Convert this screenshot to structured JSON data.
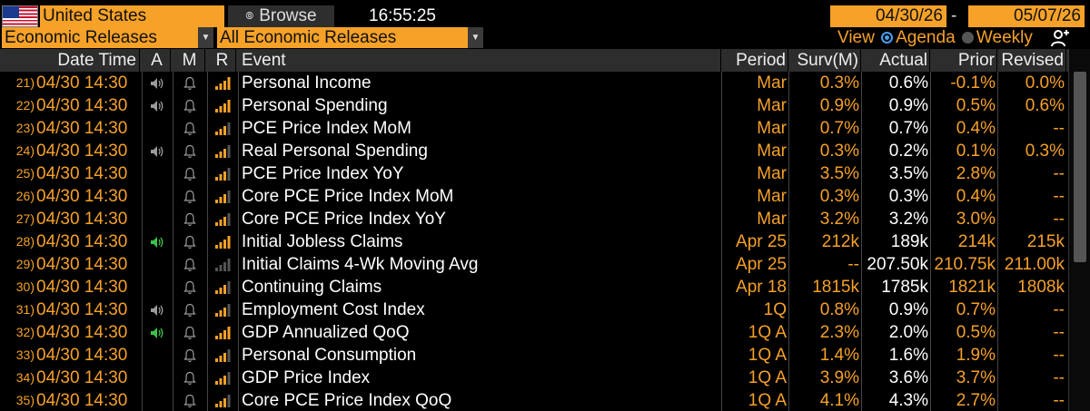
{
  "toolbar": {
    "country": "United States",
    "browse_label": "Browse",
    "time": "16:55:25",
    "date_from": "04/30/26",
    "date_separator": "-",
    "date_to": "05/07/26",
    "release_type": "Economic Releases",
    "release_filter": "All Economic Releases",
    "view_label": "View",
    "view_agenda": "Agenda",
    "view_weekly": "Weekly",
    "selected_view": "Agenda"
  },
  "colors": {
    "accent": "#f6a128",
    "bar_active": "#f6a128",
    "bar_inactive": "#555555",
    "speaker_active": "#3cc24a",
    "speaker_inactive": "#9a9a9a"
  },
  "table": {
    "headers": {
      "date_time": "Date Time",
      "a": "A",
      "m": "M",
      "r": "R",
      "event": "Event",
      "period": "Period",
      "surv": "Surv(M)",
      "actual": "Actual",
      "prior": "Prior",
      "revised": "Revised"
    },
    "rows": [
      {
        "num": "21)",
        "date": "04/30 14:30",
        "speaker": "inactive",
        "relevance": 4,
        "event": "Personal Income",
        "period": "Mar",
        "surv": "0.3%",
        "actual": "0.6%",
        "prior": "-0.1%",
        "revised": "0.0%"
      },
      {
        "num": "22)",
        "date": "04/30 14:30",
        "speaker": "inactive",
        "relevance": 4,
        "event": "Personal Spending",
        "period": "Mar",
        "surv": "0.9%",
        "actual": "0.9%",
        "prior": "0.5%",
        "revised": "0.6%"
      },
      {
        "num": "23)",
        "date": "04/30 14:30",
        "speaker": "none",
        "relevance": 3,
        "event": "PCE Price Index MoM",
        "period": "Mar",
        "surv": "0.7%",
        "actual": "0.7%",
        "prior": "0.4%",
        "revised": "--"
      },
      {
        "num": "24)",
        "date": "04/30 14:30",
        "speaker": "inactive",
        "relevance": 3,
        "event": "Real Personal Spending",
        "period": "Mar",
        "surv": "0.3%",
        "actual": "0.2%",
        "prior": "0.1%",
        "revised": "0.3%"
      },
      {
        "num": "25)",
        "date": "04/30 14:30",
        "speaker": "none",
        "relevance": 3,
        "event": "PCE Price Index YoY",
        "period": "Mar",
        "surv": "3.5%",
        "actual": "3.5%",
        "prior": "2.8%",
        "revised": "--"
      },
      {
        "num": "26)",
        "date": "04/30 14:30",
        "speaker": "none",
        "relevance": 3,
        "event": "Core PCE Price Index MoM",
        "period": "Mar",
        "surv": "0.3%",
        "actual": "0.3%",
        "prior": "0.4%",
        "revised": "--"
      },
      {
        "num": "27)",
        "date": "04/30 14:30",
        "speaker": "none",
        "relevance": 3,
        "event": "Core PCE Price Index YoY",
        "period": "Mar",
        "surv": "3.2%",
        "actual": "3.2%",
        "prior": "3.0%",
        "revised": "--"
      },
      {
        "num": "28)",
        "date": "04/30 14:30",
        "speaker": "active",
        "relevance": 4,
        "event": "Initial Jobless Claims",
        "period": "Apr 25",
        "surv": "212k",
        "actual": "189k",
        "prior": "214k",
        "revised": "215k"
      },
      {
        "num": "29)",
        "date": "04/30 14:30",
        "speaker": "none",
        "relevance": 0,
        "event": "Initial Claims 4-Wk Moving Avg",
        "period": "Apr 25",
        "surv": "--",
        "actual": "207.50k",
        "prior": "210.75k",
        "revised": "211.00k"
      },
      {
        "num": "30)",
        "date": "04/30 14:30",
        "speaker": "none",
        "relevance": 3,
        "event": "Continuing Claims",
        "period": "Apr 18",
        "surv": "1815k",
        "actual": "1785k",
        "prior": "1821k",
        "revised": "1808k"
      },
      {
        "num": "31)",
        "date": "04/30 14:30",
        "speaker": "inactive",
        "relevance": 3,
        "event": "Employment Cost Index",
        "period": "1Q",
        "surv": "0.8%",
        "actual": "0.9%",
        "prior": "0.7%",
        "revised": "--"
      },
      {
        "num": "32)",
        "date": "04/30 14:30",
        "speaker": "active",
        "relevance": 4,
        "event": "GDP Annualized QoQ",
        "period": "1Q A",
        "surv": "2.3%",
        "actual": "2.0%",
        "prior": "0.5%",
        "revised": "--"
      },
      {
        "num": "33)",
        "date": "04/30 14:30",
        "speaker": "none",
        "relevance": 3,
        "event": "Personal Consumption",
        "period": "1Q A",
        "surv": "1.4%",
        "actual": "1.6%",
        "prior": "1.9%",
        "revised": "--"
      },
      {
        "num": "34)",
        "date": "04/30 14:30",
        "speaker": "none",
        "relevance": 3,
        "event": "GDP Price Index",
        "period": "1Q A",
        "surv": "3.9%",
        "actual": "3.6%",
        "prior": "3.7%",
        "revised": "--"
      },
      {
        "num": "35)",
        "date": "04/30 14:30",
        "speaker": "none",
        "relevance": 3,
        "event": "Core PCE Price Index QoQ",
        "period": "1Q A",
        "surv": "4.1%",
        "actual": "4.3%",
        "prior": "2.7%",
        "revised": "--"
      }
    ]
  }
}
